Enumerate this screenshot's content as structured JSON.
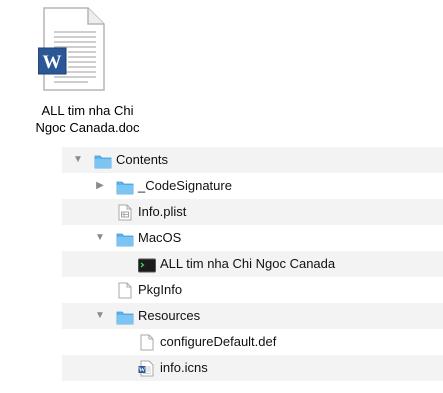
{
  "desktop_file": {
    "name_line1": "ALL tim nha Chi",
    "name_line2": "Ngoc Canada.doc",
    "icon": "word-document-icon"
  },
  "tree": [
    {
      "label": "Contents",
      "depth": 0,
      "disclosure": "expanded",
      "icon": "folder-icon"
    },
    {
      "label": "_CodeSignature",
      "depth": 1,
      "disclosure": "collapsed",
      "icon": "folder-icon"
    },
    {
      "label": "Info.plist",
      "depth": 1,
      "disclosure": "none",
      "icon": "plist-file-icon"
    },
    {
      "label": "MacOS",
      "depth": 1,
      "disclosure": "expanded",
      "icon": "folder-icon"
    },
    {
      "label": "ALL tim nha Chi Ngoc Canada",
      "depth": 2,
      "disclosure": "none",
      "icon": "terminal-executable-icon"
    },
    {
      "label": "PkgInfo",
      "depth": 1,
      "disclosure": "none",
      "icon": "blank-file-icon"
    },
    {
      "label": "Resources",
      "depth": 1,
      "disclosure": "expanded",
      "icon": "folder-icon"
    },
    {
      "label": "configureDefault.def",
      "depth": 2,
      "disclosure": "none",
      "icon": "blank-file-icon"
    },
    {
      "label": "info.icns",
      "depth": 2,
      "disclosure": "none",
      "icon": "word-document-icon"
    }
  ],
  "colors": {
    "folder": "#5ab4ef",
    "word_blue": "#2b5797",
    "row_stripe": "#f3f3f3"
  }
}
